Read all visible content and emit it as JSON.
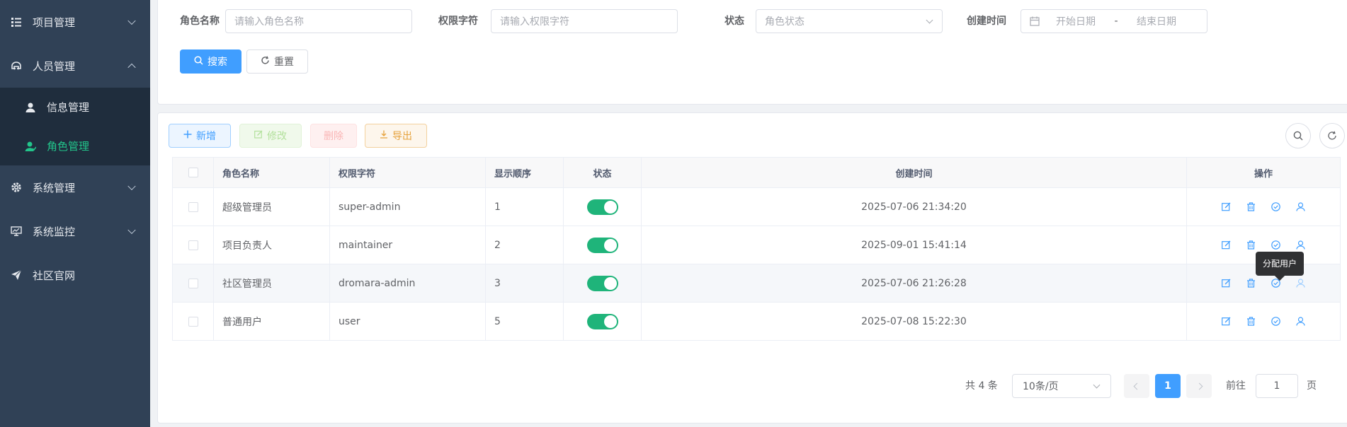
{
  "sidebar": {
    "items": [
      {
        "label": "项目管理",
        "icon": "list-icon"
      },
      {
        "label": "人员管理",
        "icon": "team-icon"
      },
      {
        "label": "信息管理",
        "icon": "user-icon"
      },
      {
        "label": "角色管理",
        "icon": "user-role-icon"
      },
      {
        "label": "系统管理",
        "icon": "gear-icon"
      },
      {
        "label": "系统监控",
        "icon": "monitor-icon"
      },
      {
        "label": "社区官网",
        "icon": "send-icon"
      }
    ]
  },
  "search": {
    "role_name_label": "角色名称",
    "role_name_placeholder": "请输入角色名称",
    "perm_label": "权限字符",
    "perm_placeholder": "请输入权限字符",
    "status_label": "状态",
    "status_placeholder": "角色状态",
    "created_label": "创建时间",
    "start_placeholder": "开始日期",
    "range_sep": "-",
    "end_placeholder": "结束日期",
    "search_button": "搜索",
    "reset_button": "重置"
  },
  "toolbar": {
    "add": "新增",
    "edit": "修改",
    "delete": "删除",
    "export": "导出"
  },
  "table": {
    "headers": [
      "角色名称",
      "权限字符",
      "显示顺序",
      "状态",
      "创建时间",
      "操作"
    ],
    "rows": [
      {
        "name": "超级管理员",
        "key": "super-admin",
        "order": "1",
        "status": true,
        "created": "2025-07-06 21:34:20"
      },
      {
        "name": "项目负责人",
        "key": "maintainer",
        "order": "2",
        "status": true,
        "created": "2025-09-01 15:41:14"
      },
      {
        "name": "社区管理员",
        "key": "dromara-admin",
        "order": "3",
        "status": true,
        "created": "2025-07-06 21:26:28"
      },
      {
        "name": "普通用户",
        "key": "user",
        "order": "5",
        "status": true,
        "created": "2025-07-08 15:22:30"
      }
    ],
    "tooltip": "分配用户"
  },
  "pagination": {
    "total_text": "共 4 条",
    "page_size": "10条/页",
    "current_page": "1",
    "goto_label": "前往",
    "goto_value": "1",
    "page_suffix": "页"
  },
  "colors": {
    "sidebar_bg": "#304156",
    "submenu_bg": "#1f2d3d",
    "active_green": "#22c58b",
    "primary": "#409eff",
    "switch_on": "#1fb47a"
  }
}
